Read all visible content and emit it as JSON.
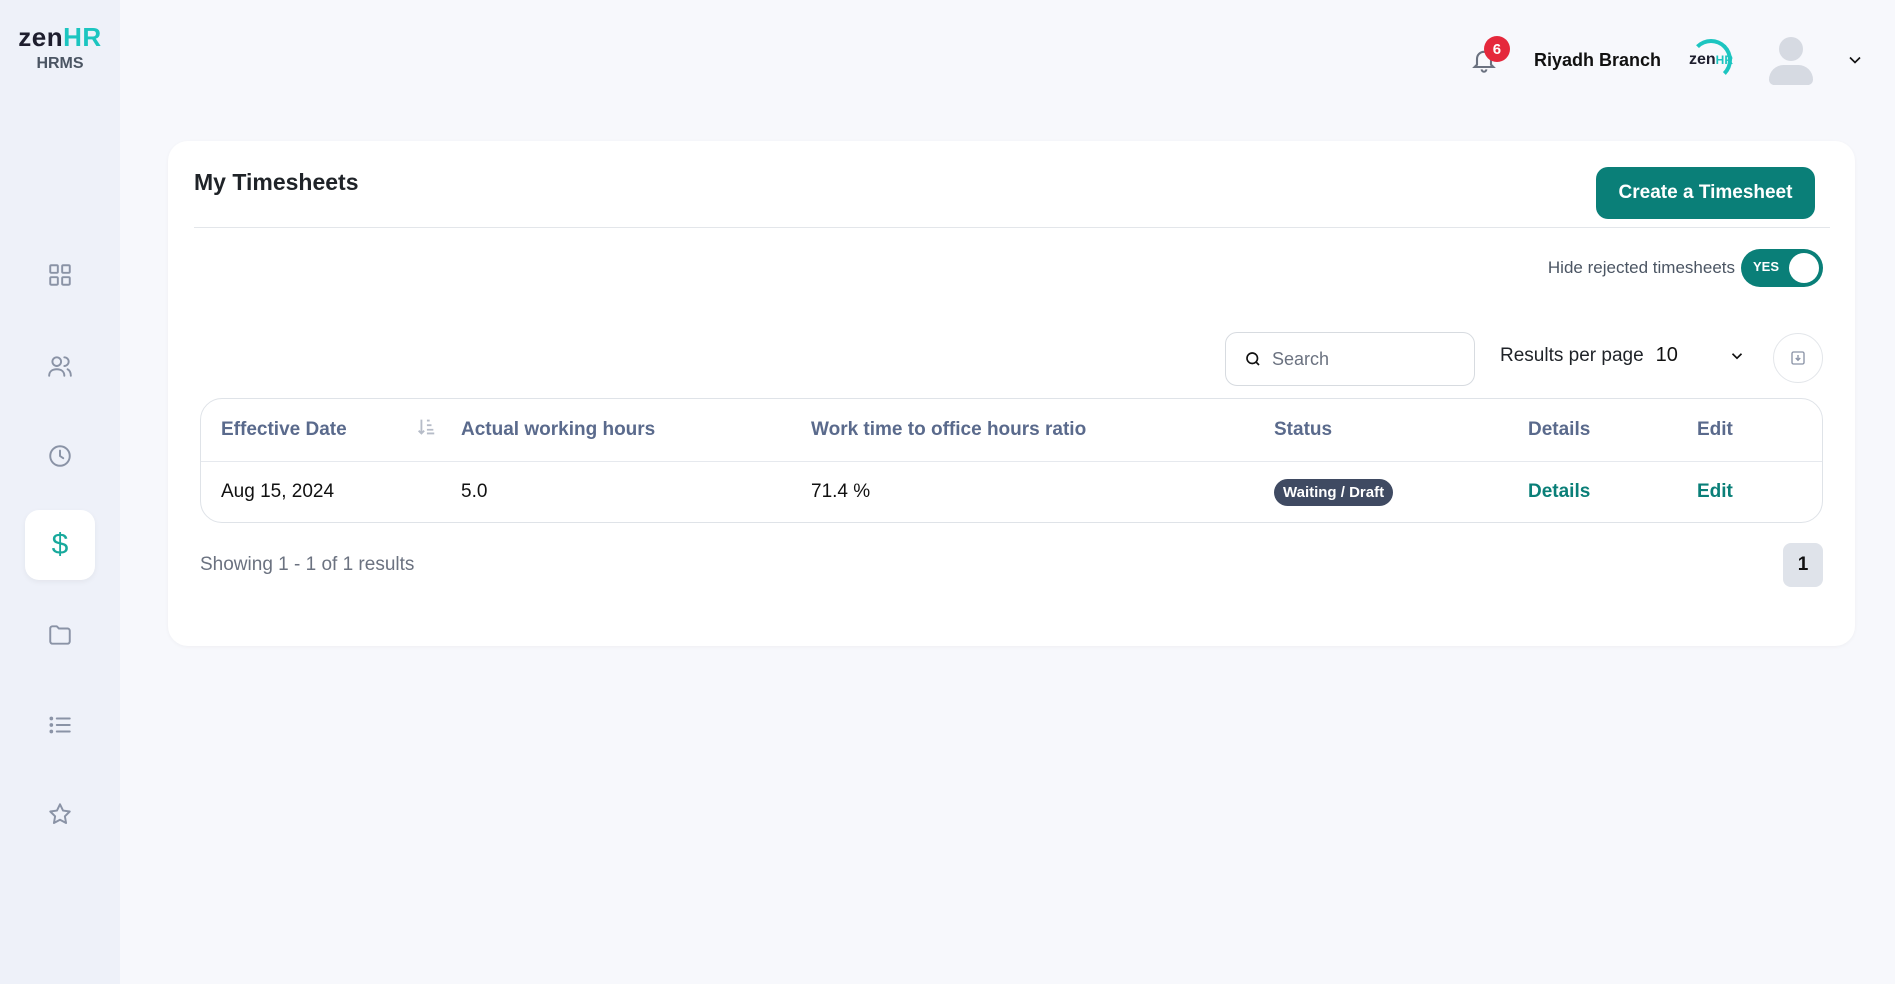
{
  "brand": {
    "logo_main": "zen",
    "logo_accent": "HR",
    "logo_sub": "HRMS"
  },
  "sidebar": {
    "items": [
      {
        "name": "dashboard-icon",
        "active": false
      },
      {
        "name": "users-icon",
        "active": false
      },
      {
        "name": "clock-icon",
        "active": false
      },
      {
        "name": "dollar-icon",
        "active": true,
        "glyph": "$"
      },
      {
        "name": "folder-icon",
        "active": false
      },
      {
        "name": "list-icon",
        "active": false
      },
      {
        "name": "star-icon",
        "active": false
      }
    ]
  },
  "header": {
    "notification_count": "6",
    "branch_name": "Riyadh Branch",
    "company_logo_main": "zen",
    "company_logo_accent": "HR"
  },
  "page": {
    "title": "My Timesheets",
    "create_button": "Create a Timesheet",
    "toggle_label": "Hide rejected timesheets",
    "toggle_value": "YES",
    "search_placeholder": "Search",
    "results_per_page_label": "Results per page",
    "results_per_page_value": "10"
  },
  "table": {
    "columns": [
      "Effective Date",
      "Actual working hours",
      "Work time to office hours ratio",
      "Status",
      "Details",
      "Edit"
    ],
    "rows": [
      {
        "effective_date": "Aug 15, 2024",
        "actual_hours": "5.0",
        "ratio": "71.4 %",
        "status": "Waiting / Draft",
        "details": "Details",
        "edit": "Edit"
      }
    ]
  },
  "pagination": {
    "summary": "Showing 1 - 1 of 1 results",
    "current_page": "1"
  },
  "colors": {
    "accent": "#0a7f78",
    "brand_teal": "#1cc5c0",
    "badge_red": "#e5283c",
    "status_badge": "#3f4a62"
  }
}
